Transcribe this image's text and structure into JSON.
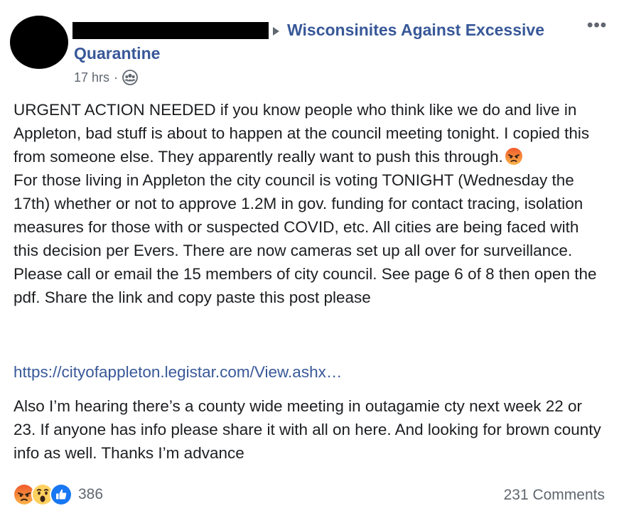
{
  "post": {
    "author_redacted": true,
    "group_name": "Wisconsinites Against Excessive Quarantine",
    "timestamp": "17 hrs",
    "separator": "·",
    "privacy_icon": "group-icon",
    "more_label": "•••",
    "paragraph1": "URGENT ACTION NEEDED if you know people who think like we do and live in Appleton, bad stuff is about to happen at the council meeting tonight. I copied this from someone else. They apparently really want to push this through.",
    "paragraph2": "For those living in Appleton the city council is voting TONIGHT (Wednesday the 17th) whether or not to approve 1.2M in gov. funding for contact tracing, isolation measures for those with or suspected COVID, etc. All cities are being faced with this decision per Evers. There are now cameras set up all over for surveillance. Please call or email the 15 members of city council. See page 6 of 8 then open the pdf. Share the link and copy paste this post please",
    "link": "https://cityofappleton.legistar.com/View.ashx…",
    "paragraph3": "Also I’m hearing there’s a county wide meeting in outagamie cty next week 22 or 23. If anyone has info please share it with all on here. And looking for brown county info as well. Thanks I’m advance"
  },
  "footer": {
    "reactions": [
      "angry",
      "wow",
      "like"
    ],
    "reaction_count": "386",
    "comments": "231 Comments"
  },
  "colors": {
    "link": "#385898",
    "text": "#1c1e21",
    "muted": "#606770",
    "like": "#1877f2",
    "emoji_yellow": "#fdd05f",
    "emoji_angry": "#f05a2a"
  }
}
